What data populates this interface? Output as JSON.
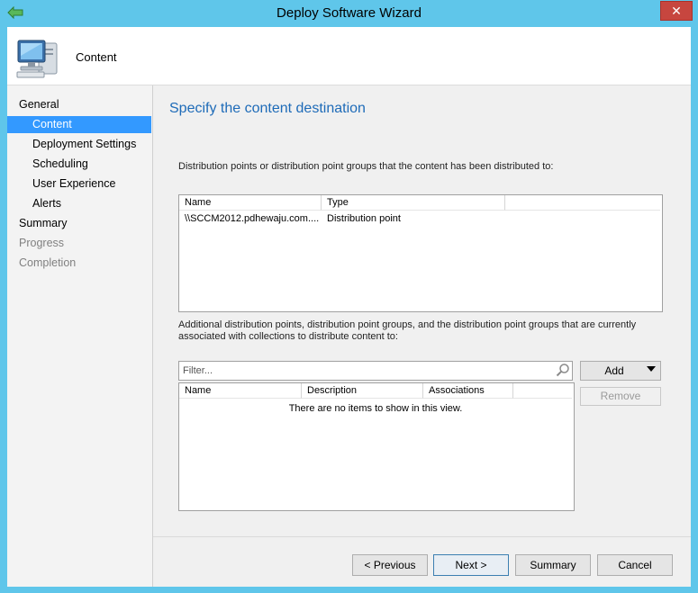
{
  "window": {
    "title": "Deploy Software Wizard",
    "close_label": "✕"
  },
  "header": {
    "title": "Content",
    "icon": "computer-icon"
  },
  "nav": {
    "items": [
      {
        "label": "General",
        "state": "normal"
      },
      {
        "label": "Content",
        "state": "selected"
      },
      {
        "label": "Deployment Settings",
        "state": "normal"
      },
      {
        "label": "Scheduling",
        "state": "normal"
      },
      {
        "label": "User Experience",
        "state": "normal"
      },
      {
        "label": "Alerts",
        "state": "normal"
      },
      {
        "label": "Summary",
        "state": "normal"
      },
      {
        "label": "Progress",
        "state": "disabled"
      },
      {
        "label": "Completion",
        "state": "disabled"
      }
    ]
  },
  "main": {
    "heading": "Specify the content destination",
    "distributed_label": "Distribution points or distribution point groups that the content has been distributed to:",
    "distributed_list": {
      "columns": [
        "Name",
        "Type"
      ],
      "rows": [
        {
          "name": "\\\\SCCM2012.pdhewaju.com....",
          "type": "Distribution point"
        }
      ]
    },
    "additional_label": "Additional distribution points, distribution point groups, and the distribution point groups that are currently associated with collections to distribute content to:",
    "filter_placeholder": "Filter...",
    "additional_list": {
      "columns": [
        "Name",
        "Description",
        "Associations"
      ],
      "empty_text": "There are no items to show in this view."
    },
    "add_label": "Add",
    "remove_label": "Remove"
  },
  "footer": {
    "previous_label": "< Previous",
    "next_label": "Next >",
    "summary_label": "Summary",
    "cancel_label": "Cancel"
  },
  "colors": {
    "accent": "#3399ff",
    "heading": "#1e6bb8",
    "frame": "#5fc6ea",
    "close": "#c7463f"
  }
}
